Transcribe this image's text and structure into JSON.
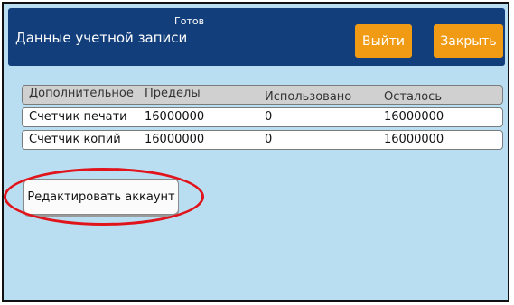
{
  "header": {
    "status": "Готов",
    "title": "Данные учетной записи",
    "logout_label": "Выйти",
    "close_label": "Закрыть"
  },
  "table": {
    "columns": [
      "Дополнительное",
      "Пределы",
      "Использовано",
      "Осталось"
    ],
    "rows": [
      [
        "Счетчик печати",
        "16000000",
        "0",
        "16000000"
      ],
      [
        "Счетчик копий",
        "16000000",
        "0",
        "16000000"
      ]
    ]
  },
  "actions": {
    "edit_account_label": "Редактировать аккаунт"
  },
  "colors": {
    "background": "#b9def1",
    "header": "#123e7b",
    "accent_button": "#f19b14",
    "highlight": "#e1131b"
  }
}
